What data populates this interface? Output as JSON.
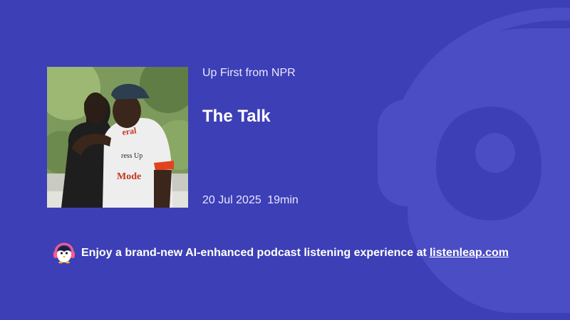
{
  "theme": {
    "background": "#3d3fb6",
    "watermark": "#4b4ec4",
    "accent": "#ffffff"
  },
  "podcast": {
    "show_name": "Up First from NPR",
    "episode_title": "The Talk",
    "date": "20 Jul 2025",
    "duration": "19min",
    "cover_icon": "episode-cover-image"
  },
  "promo": {
    "icon": "listenleap-penguin-logo",
    "text": "Enjoy a brand-new AI-enhanced podcast listening experience at",
    "link_text": "listenleap.com"
  },
  "background_icon": "listenleap-penguin-watermark"
}
